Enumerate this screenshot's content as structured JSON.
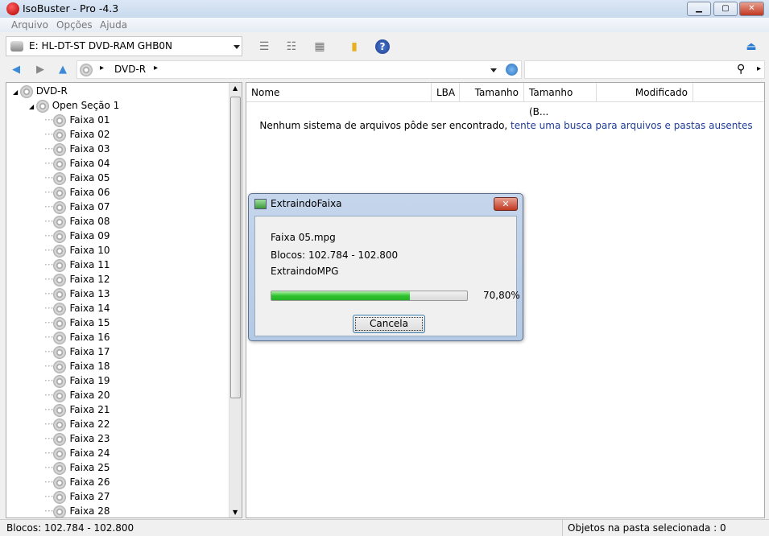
{
  "window": {
    "title": "IsoBuster - Pro -4.3",
    "minimize": "▁",
    "maximize": "▢",
    "close": "✕"
  },
  "menu": [
    "Arquivo",
    "Opções",
    "Ajuda"
  ],
  "toolbar": {
    "drive": "E: HL-DT-ST  DVD-RAM GHB0N"
  },
  "address": {
    "path": "DVD-R",
    "sep": "▸"
  },
  "tree": {
    "root": "DVD-R",
    "session": "Open Seção 1",
    "tracks": [
      "Faixa 01",
      "Faixa 02",
      "Faixa 03",
      "Faixa 04",
      "Faixa 05",
      "Faixa 06",
      "Faixa 07",
      "Faixa 08",
      "Faixa 09",
      "Faixa 10",
      "Faixa 11",
      "Faixa 12",
      "Faixa 13",
      "Faixa 14",
      "Faixa 15",
      "Faixa 16",
      "Faixa 17",
      "Faixa 18",
      "Faixa 19",
      "Faixa 20",
      "Faixa 21",
      "Faixa 22",
      "Faixa 23",
      "Faixa 24",
      "Faixa 25",
      "Faixa 26",
      "Faixa 27",
      "Faixa 28"
    ]
  },
  "list": {
    "columns": [
      "Nome",
      "LBA",
      "Tamanho",
      "Tamanho (B...",
      "Modificado"
    ],
    "message": "Nenhum sistema de arquivos pôde ser encontrado,",
    "link": "tente uma busca para arquivos e pastas ausentes"
  },
  "dialog": {
    "title": "ExtraindoFaixa",
    "file": "Faixa 05.mpg",
    "blocks": "Blocos: 102.784 - 102.800",
    "action": "ExtraindoMPG",
    "progress": 70.8,
    "progress_label": "70,80%",
    "cancel": "Cancela"
  },
  "status": {
    "left": "Blocos: 102.784 - 102.800",
    "right": "Objetos na pasta selecionada : 0"
  }
}
